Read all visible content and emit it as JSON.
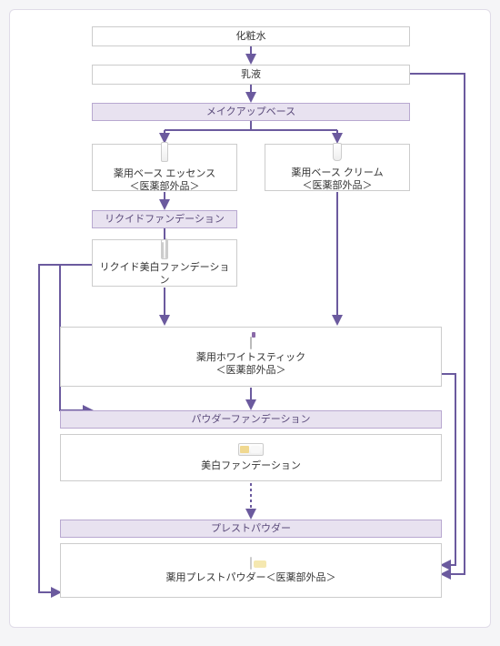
{
  "colors": {
    "arrow": "#6b5a9e",
    "header_bg": "#e8e2f0",
    "header_text": "#5a4a7a"
  },
  "steps": {
    "lotion": "化粧水",
    "emulsion": "乳液",
    "makeup_base": "メイクアップベース",
    "base_essence_l1": "薬用ベース エッセンス",
    "base_essence_l2": "＜医薬部外品＞",
    "base_cream_l1": "薬用ベース クリーム",
    "base_cream_l2": "＜医薬部外品＞",
    "liquid_foundation": "リクイドファンデーション",
    "liquid_whitening": "リクイド美白ファンデーション",
    "white_stick_l1": "薬用ホワイトスティック",
    "white_stick_l2": "＜医薬部外品＞",
    "powder_foundation": "パウダーファンデーション",
    "whitening_foundation": "美白ファンデーション",
    "pressed_powder": "プレストパウダー",
    "medicated_pressed": "薬用プレストパウダー＜医薬部外品＞"
  }
}
